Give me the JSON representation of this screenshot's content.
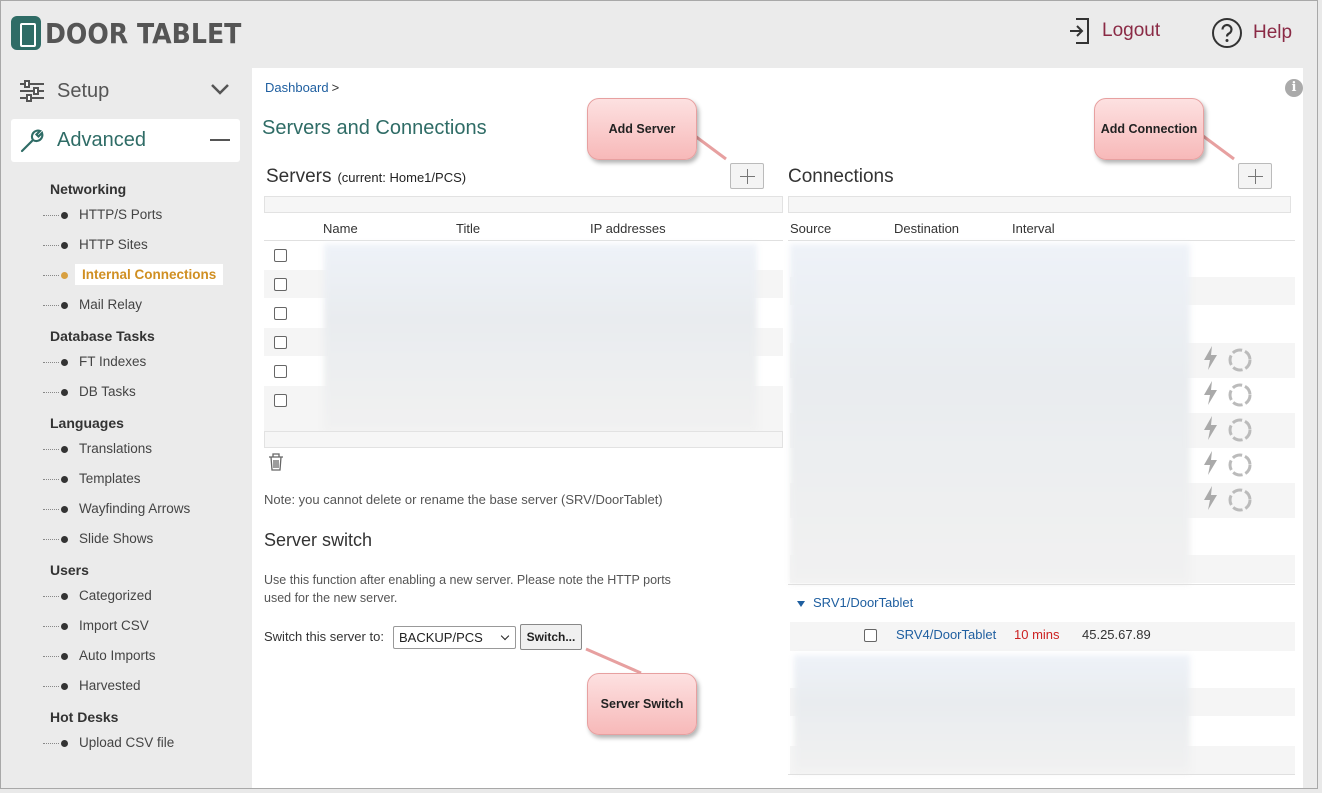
{
  "brand": {
    "logo_text": "DOOR TABLET"
  },
  "header": {
    "logout_label": "Logout",
    "help_label": "Help"
  },
  "sidebar": {
    "setup_label": "Setup",
    "advanced_label": "Advanced",
    "groups": [
      {
        "title": "Networking",
        "items": [
          "HTTP/S Ports",
          "HTTP Sites",
          "Internal Connections",
          "Mail Relay"
        ]
      },
      {
        "title": "Database Tasks",
        "items": [
          "FT Indexes",
          "DB Tasks"
        ]
      },
      {
        "title": "Languages",
        "items": [
          "Translations",
          "Templates",
          "Wayfinding Arrows",
          "Slide Shows"
        ]
      },
      {
        "title": "Users",
        "items": [
          "Categorized",
          "Import CSV",
          "Auto Imports",
          "Harvested"
        ]
      },
      {
        "title": "Hot Desks",
        "items": [
          "Upload CSV file"
        ]
      }
    ],
    "active_item": "Internal Connections"
  },
  "main": {
    "breadcrumb": "Dashboard",
    "breadcrumb_sep": ">",
    "page_title": "Servers and Connections",
    "servers": {
      "title": "Servers",
      "current_label": "(current:",
      "current_value": "Home1/PCS",
      "current_close": ")",
      "columns": [
        "Name",
        "Title",
        "IP addresses"
      ],
      "note": "Note: you cannot delete or rename the base server (SRV/DoorTablet)"
    },
    "switch": {
      "title": "Server switch",
      "description": "Use this function after enabling a new server.  Please note the HTTP ports used for the new server.",
      "label": "Switch this server to:",
      "selected": "BACKUP/PCS",
      "button": "Switch..."
    },
    "connections": {
      "title": "Connections",
      "columns": [
        "Source",
        "Destination",
        "Interval"
      ],
      "group_label": "SRV1/DoorTablet",
      "visible_row": {
        "destination": "SRV4/DoorTablet",
        "interval": "10 mins",
        "ip": "45.25.67.89"
      }
    }
  },
  "callouts": {
    "add_server": "Add Server",
    "add_connection": "Add Connection",
    "server_switch": "Server Switch"
  },
  "colors": {
    "brand": "#2f6c66",
    "accent": "#8a2a45",
    "link": "#1f5fa0",
    "active": "#d08f22",
    "interval": "#cc2222"
  }
}
